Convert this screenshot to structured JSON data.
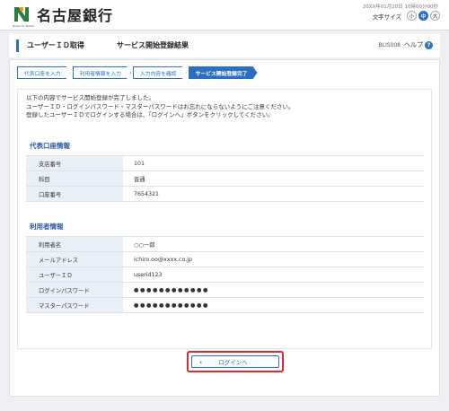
{
  "header": {
    "logo_text": "名古屋銀行",
    "logo_sub": "NAGOYA BANK",
    "datetime": "20XX年01月20日 10時00分00秒",
    "font_size_label": "文字サイズ",
    "font_sizes": [
      "小",
      "中",
      "大"
    ],
    "font_size_selected": "中",
    "brand_color": "#2a7d3b"
  },
  "title": {
    "main": "ユーザーＩＤ取得",
    "sub": "サービス開始登録結果",
    "code": "BLIS008",
    "help_label": "ヘルプ",
    "help_icon": "?"
  },
  "steps": [
    {
      "label": "代表口座を入力",
      "active": false
    },
    {
      "label": "利用者情報を入力",
      "active": false
    },
    {
      "label": "入力内容を確認",
      "active": false
    },
    {
      "label": "サービス開始登録完了",
      "active": true
    }
  ],
  "message": [
    "以下の内容でサービス開始登録が完了しました。",
    "ユーザーＩＤ・ログインパスワード・マスターパスワードはお忘れにならないようにご注意ください。",
    "登録したユーザーＩＤでログインする場合は、「ログインへ」ボタンをクリックしてください。"
  ],
  "account_section": {
    "title": "代表口座情報",
    "rows": [
      {
        "label": "支店番号",
        "value": "101"
      },
      {
        "label": "科目",
        "value": "普通"
      },
      {
        "label": "口座番号",
        "value": "7654321"
      }
    ]
  },
  "user_section": {
    "title": "利用者情報",
    "rows": [
      {
        "label": "利用者名",
        "value": "○○一郎"
      },
      {
        "label": "メールアドレス",
        "value": "ichiro.oo@xxxx.co.jp"
      },
      {
        "label": "ユーザーＩＤ",
        "value": "userid123"
      },
      {
        "label": "ログインパスワード",
        "value": "●●●●●●●●●●●●"
      },
      {
        "label": "マスターパスワード",
        "value": "●●●●●●●●●●●●"
      }
    ]
  },
  "login_button": {
    "label": "ログインへ",
    "icon": "chevron-left-icon"
  },
  "accent_color": "#2b6fbf",
  "highlight_color": "#e0282e"
}
